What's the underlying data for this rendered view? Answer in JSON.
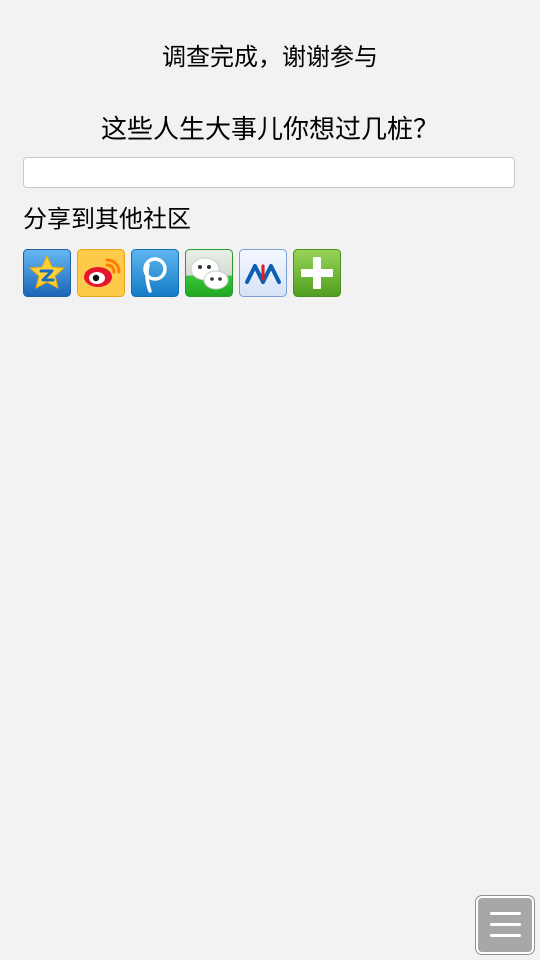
{
  "page": {
    "title": "调查完成，谢谢参与",
    "question": "这些人生大事儿你想过几桩？",
    "answer_value": ""
  },
  "share": {
    "label": "分享到其他社区",
    "icons": [
      {
        "name": "qzone-icon",
        "color": "#2e7ad3"
      },
      {
        "name": "weibo-icon",
        "color": "#e6162d"
      },
      {
        "name": "tencent-weibo-icon",
        "color": "#1f90d8"
      },
      {
        "name": "wechat-icon",
        "color": "#34b233"
      },
      {
        "name": "renren-icon",
        "color": "#0b5fb3"
      },
      {
        "name": "more-share-icon",
        "color": "#62b22f"
      }
    ]
  },
  "floating": {
    "menu_icon": "hamburger-menu-icon"
  }
}
